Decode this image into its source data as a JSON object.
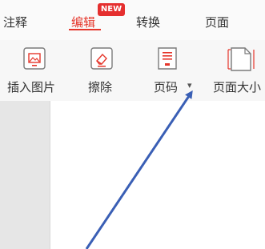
{
  "tabs": [
    {
      "label": "注释"
    },
    {
      "label": "编辑"
    },
    {
      "label": "转换"
    },
    {
      "label": "页面"
    }
  ],
  "new_badge": "NEW",
  "tools": [
    {
      "label": "插入图片",
      "icon": "insert-image-icon"
    },
    {
      "label": "擦除",
      "icon": "eraser-icon"
    },
    {
      "label": "页码",
      "icon": "page-number-icon"
    },
    {
      "label": "页面大小",
      "icon": "page-size-icon"
    }
  ],
  "dropdown_glyph": "▾",
  "colors": {
    "accent": "#e5362b",
    "badge": "#e52f2f",
    "arrow": "#3a5fb5"
  }
}
